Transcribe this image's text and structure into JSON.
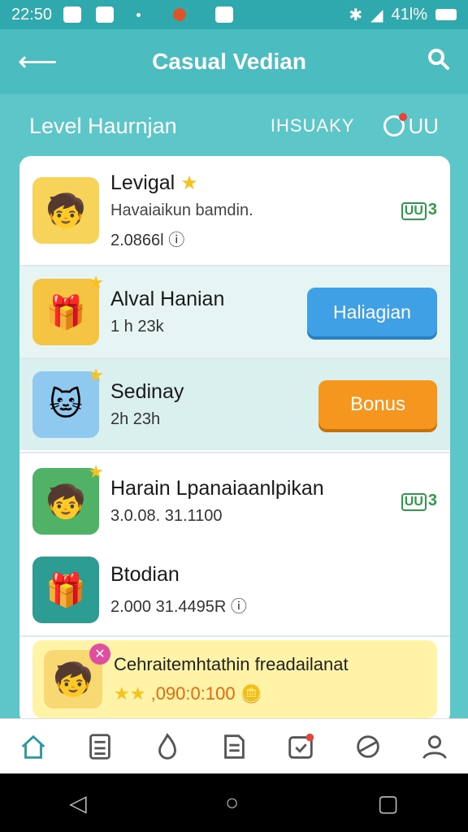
{
  "status": {
    "time": "22:50",
    "battery": "41l%"
  },
  "app_bar": {
    "title": "Casual Vedian"
  },
  "sub_header": {
    "level": "Level Haurnjan",
    "tab": "IHSUAKY",
    "timer_label": "UU"
  },
  "list": [
    {
      "name": "Levigal",
      "desc": "Havaiaikun bamdin.",
      "meta": "2.0866l",
      "badge_box": "UU",
      "badge_num": "3"
    },
    {
      "name": "Alval Hanian",
      "meta": "1 h 23k",
      "button": "Haliagian"
    },
    {
      "name": "Sedinay",
      "meta": "2h 23h",
      "button": "Bonus"
    },
    {
      "name": "Harain Lpanaiaanlpikan",
      "meta": "3.0.08.  31.1100",
      "badge_box": "UU",
      "badge_num": "3"
    },
    {
      "name": "Btodian",
      "meta": "2.000  31.4495R"
    }
  ],
  "promo": {
    "headline": "Cehraitemhtathin freadailanat",
    "reward": ",090:0:100"
  },
  "icons": {
    "back": "arrow-left-icon",
    "search": "search-icon",
    "nav": [
      "home-icon",
      "calculator-icon",
      "flame-icon",
      "document-icon",
      "calendar-icon",
      "globe-icon",
      "profile-icon"
    ]
  },
  "colors": {
    "teal": "#4bbdc1",
    "blue": "#3fa0e6",
    "orange": "#f5961e",
    "green": "#2d9b48"
  }
}
